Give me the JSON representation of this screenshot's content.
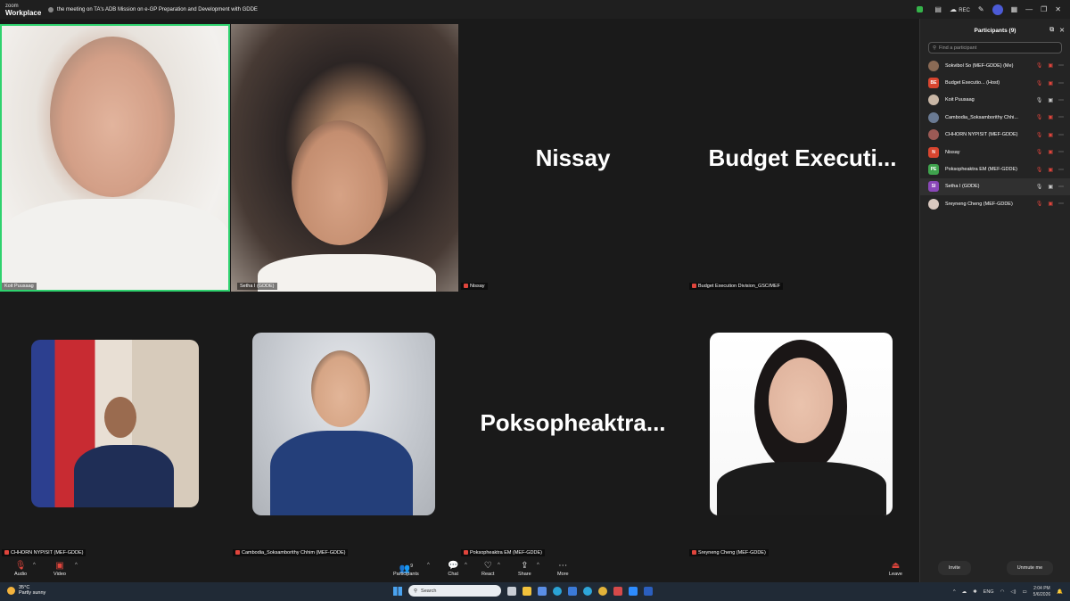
{
  "window": {
    "app_line1": "zoom",
    "app_line2": "Workplace",
    "title": "the meeting on TA's ADB Mission on e-GP Preparation and Development with GDDE",
    "rec_label": "REC"
  },
  "tiles": {
    "koit": {
      "label": "Koit Puusaag"
    },
    "setha": {
      "label": "Setha I (GDDE)"
    },
    "nissay": {
      "big_name": "Nissay",
      "label": "Nissay"
    },
    "budget": {
      "big_name": "Budget  Executi...",
      "label": "Budget Execution Division_GSC/MEF"
    },
    "chhorn": {
      "label": "CHHORN NYPISIT (MEF-GDDE)"
    },
    "cambodia": {
      "label": "Cambodia_Soksamborithy Chhim (MEF-GDDE)"
    },
    "poksopheak": {
      "big_name": "Poksopheaktra...",
      "label": "Poksopheaktra EM (MEF-GDDE)"
    },
    "sreyneng": {
      "label": "Sreyneng Cheng (MEF-GDDE)"
    }
  },
  "participants_panel": {
    "title": "Participants (9)",
    "search_placeholder": "Find a participant",
    "items": [
      {
        "name": "Sokvibol So (MEF-GDDE) (Me)",
        "avatar": "photo",
        "color": "#8a6a55"
      },
      {
        "name": "Budget Executio...  (Host)",
        "avatar": "BE",
        "color": "#d8452f"
      },
      {
        "name": "Koit Puusaag",
        "avatar": "photo",
        "color": "#c9b7a6"
      },
      {
        "name": "Cambodia_Soksamborithy Chhi...",
        "avatar": "photo",
        "color": "#6a7a93"
      },
      {
        "name": "CHHORN NYPISIT (MEF-GDDE)",
        "avatar": "photo",
        "color": "#9b5a55"
      },
      {
        "name": "Nissay",
        "avatar": "N",
        "color": "#d8452f"
      },
      {
        "name": "Poksopheaktra EM (MEF-GDDE)",
        "avatar": "PE",
        "color": "#3fa34d"
      },
      {
        "name": "Setha I (GDDE)",
        "avatar": "SI",
        "color": "#8a47b8"
      },
      {
        "name": "Sreyneng Cheng (MEF-GDDE)",
        "avatar": "photo",
        "color": "#d9c9c0"
      }
    ],
    "invite_label": "Invite",
    "unmute_label": "Unmute me"
  },
  "toolbar": {
    "audio": "Audio",
    "video": "Video",
    "participants": "Participants",
    "participants_count": "9",
    "chat": "Chat",
    "react": "React",
    "share": "Share",
    "more": "More",
    "leave": "Leave"
  },
  "taskbar": {
    "temp": "35°C",
    "weather": "Partly sunny",
    "search": "Search",
    "lang": "ENG",
    "time": "2:04 PM",
    "date": "5/6/2026"
  }
}
